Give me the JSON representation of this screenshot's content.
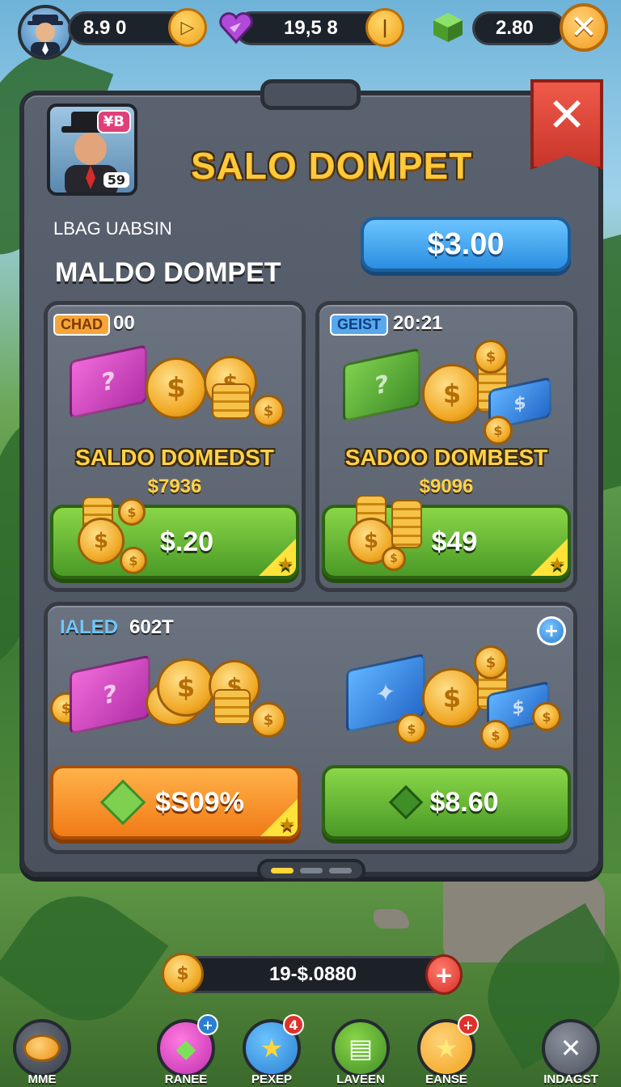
{
  "topbar": {
    "coins_value": "8.9 0",
    "gems_value": "19,5 8",
    "cash_value": "2.80",
    "coin_icon": "play-arrow-icon",
    "gem_icon": "heart-gem-icon",
    "cash_icon": "green-cube-icon",
    "close_icon": "close-icon"
  },
  "panel": {
    "title": "SALO DOMPET",
    "portrait_badge": "¥B",
    "portrait_level": "59",
    "ribbon_icon": "close-icon",
    "small_label": "LBAG UABSIN",
    "big_label": "MALDO DOMPET",
    "main_price": "$3.00"
  },
  "offers": [
    {
      "tag": "CHAD",
      "tag_value": "00",
      "name": "SALDO DOMEDST",
      "sub": "$7936",
      "price": "$.20",
      "box_color": "#c23bbb"
    },
    {
      "tag": "GEIST",
      "tag_value": "20:21",
      "name": "SADOO DOMBEST",
      "sub": "$9096",
      "price": "$49",
      "box_color": "#4f9e30"
    },
    {
      "tag": "IALED",
      "tag_value": "602T",
      "name": "",
      "sub": "",
      "price": "$S09%",
      "box_color": "#c23bbb"
    },
    {
      "tag": "",
      "tag_value": "",
      "name": "",
      "sub": "",
      "price": "$8.60",
      "box_color": "#2a78d6"
    }
  ],
  "balance": {
    "value": "19-$.0880",
    "plus": "+"
  },
  "nav": [
    {
      "label": "MME",
      "icon": "coin-stack-icon",
      "badge": ""
    },
    {
      "label": "RANEE",
      "icon": "gem-icon",
      "badge": "+"
    },
    {
      "label": "PEXEP",
      "icon": "star-icon",
      "badge": "4"
    },
    {
      "label": "LAVEEN",
      "icon": "book-icon",
      "badge": ""
    },
    {
      "label": "EANSE",
      "icon": "star-icon",
      "badge": "+"
    },
    {
      "label": "INDAGST",
      "icon": "close-icon",
      "badge": ""
    }
  ],
  "colors": {
    "title_gold": "#ffc93a",
    "green_button": "#4a9a26",
    "orange_button": "#f27a16",
    "blue_button": "#2a8ee0",
    "panel": "#4b525e"
  }
}
